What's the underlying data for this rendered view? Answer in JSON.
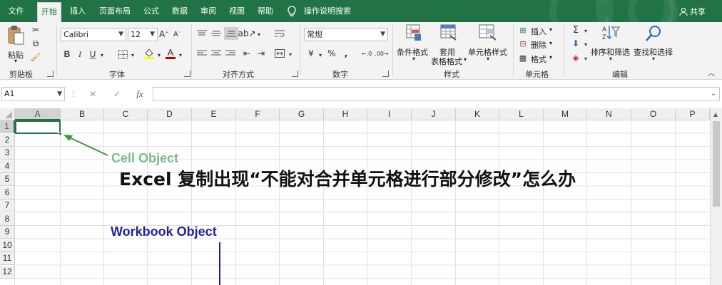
{
  "tabs": [
    {
      "label": "文件",
      "active": false
    },
    {
      "label": "开始",
      "active": true
    },
    {
      "label": "插入",
      "active": false
    },
    {
      "label": "页面布局",
      "active": false
    },
    {
      "label": "公式",
      "active": false
    },
    {
      "label": "数据",
      "active": false
    },
    {
      "label": "审阅",
      "active": false
    },
    {
      "label": "视图",
      "active": false
    },
    {
      "label": "帮助",
      "active": false
    }
  ],
  "tellme": {
    "icon": "lightbulb-icon",
    "label": "操作说明搜索"
  },
  "share": {
    "icon": "person-icon",
    "label": "共享"
  },
  "ribbon": {
    "clipboard": {
      "label": "剪贴板",
      "paste": "粘贴"
    },
    "font": {
      "label": "字体",
      "name": "Calibri",
      "size": "12",
      "bold": "B",
      "italic": "I",
      "underline": "U",
      "grow": "A",
      "shrink": "A",
      "font_color_letter": "A",
      "font_color": "#c00000",
      "highlight_color": "#ffff00"
    },
    "alignment": {
      "label": "对齐方式"
    },
    "number": {
      "label": "数字",
      "format": "常规",
      "currency": "¥",
      "percent": "%",
      "comma": ","
    },
    "styles": {
      "label": "样式",
      "conditional": "条件格式",
      "table_1": "套用",
      "table_2": "表格格式",
      "cell_styles": "单元格样式"
    },
    "cells": {
      "label": "单元格",
      "insert": "插入",
      "delete": "删除",
      "format": "格式"
    },
    "editing": {
      "label": "编辑",
      "sort": "排序和筛选",
      "find": "查找和选择"
    }
  },
  "formula_bar": {
    "name_box": "A1",
    "fx": "fx",
    "value": ""
  },
  "grid": {
    "columns": [
      "A",
      "B",
      "C",
      "D",
      "E",
      "F",
      "G",
      "H",
      "I",
      "J",
      "K",
      "L",
      "M",
      "N",
      "O",
      "P"
    ],
    "rows": [
      "1",
      "2",
      "3",
      "4",
      "5",
      "6",
      "7",
      "8",
      "9",
      "10",
      "11",
      "12"
    ],
    "selected_cell": "A1"
  },
  "annotations": {
    "cell_object": {
      "text": "Cell Object",
      "color": "#7fba8e"
    },
    "workbook_object": {
      "text": "Workbook Object",
      "color": "#1f1fa0"
    },
    "headline": {
      "text": "Excel 复制出现“不能对合并单元格进行部分修改”怎么办"
    }
  },
  "colors": {
    "accent": "#217346",
    "arrow_green": "#3a9a3a",
    "line_blue": "#1f1fa0"
  }
}
